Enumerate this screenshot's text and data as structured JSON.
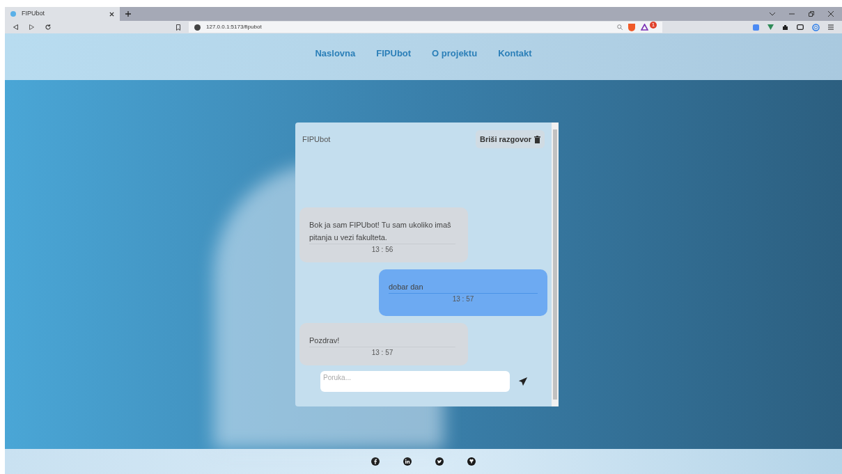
{
  "browser": {
    "tab_title": "FIPUbot",
    "url": "127.0.0.1:5173/fipubot",
    "extension_badge": "1"
  },
  "nav": {
    "links": [
      "Naslovna",
      "FIPUbot",
      "O projektu",
      "Kontakt"
    ]
  },
  "chat": {
    "title": "FIPUbot",
    "clear_button": "Briši razgovor",
    "messages": [
      {
        "kind": "bot",
        "text": "Bok ja sam FIPUbot! Tu sam ukoliko imaš pitanja u vezi fakulteta.",
        "time": "13 : 56"
      },
      {
        "kind": "user",
        "text": "dobar dan",
        "time": "13 : 57"
      },
      {
        "kind": "bot",
        "text": "Pozdrav!",
        "time": "13 : 57"
      }
    ],
    "input": {
      "placeholder": "Poruka..."
    }
  }
}
